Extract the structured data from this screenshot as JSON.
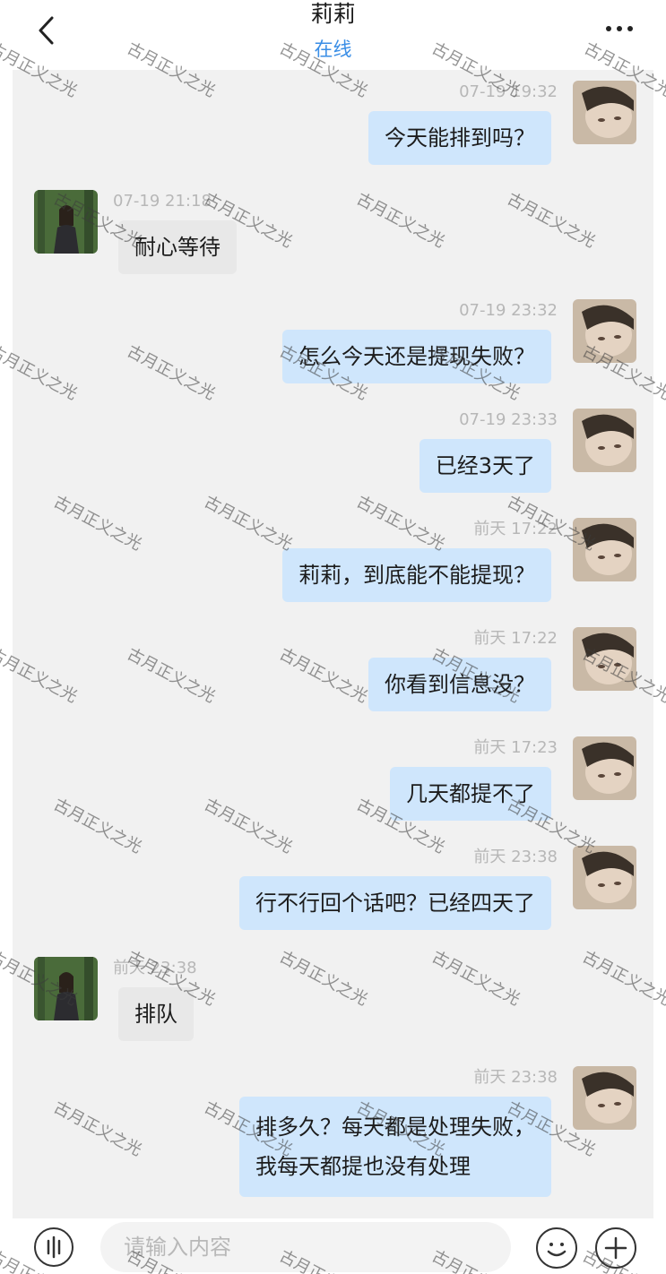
{
  "header": {
    "title": "莉莉",
    "status": "在线"
  },
  "messages": [
    {
      "dir": "out",
      "time": "07-19 19:32",
      "text": "今天能排到吗？"
    },
    {
      "dir": "in",
      "time": "07-19 21:18",
      "text": "耐心等待"
    },
    {
      "dir": "out",
      "time": "07-19 23:32",
      "text": "怎么今天还是提现失败？"
    },
    {
      "dir": "out",
      "time": "07-19 23:33",
      "text": "已经3天了"
    },
    {
      "dir": "out",
      "time": "前天 17:22",
      "text": "莉莉，到底能不能提现？"
    },
    {
      "dir": "out",
      "time": "前天 17:22",
      "text": "你看到信息没？"
    },
    {
      "dir": "out",
      "time": "前天 17:23",
      "text": "几天都提不了"
    },
    {
      "dir": "out",
      "time": "前天 23:38",
      "text": "行不行回个话吧？已经四天了"
    },
    {
      "dir": "in",
      "time": "前天 23:38",
      "text": "排队"
    },
    {
      "dir": "out",
      "time": "前天 23:38",
      "lines": [
        "排多久？每天都是处理失败，",
        "我每天都提也没有处理"
      ]
    }
  ],
  "input": {
    "placeholder": "请输入内容"
  },
  "icons": {
    "back": "chevron-left-icon",
    "more": "more-dots-icon",
    "voice": "voice-icon",
    "emoji": "emoji-icon",
    "plus": "plus-icon"
  },
  "watermark": "古月正义之光",
  "colors": {
    "status": "#3a8ee6",
    "outgoing_bubble": "#cfe6fc",
    "incoming_bubble": "#e8e8e8",
    "chat_background": "#f1f1f1"
  }
}
